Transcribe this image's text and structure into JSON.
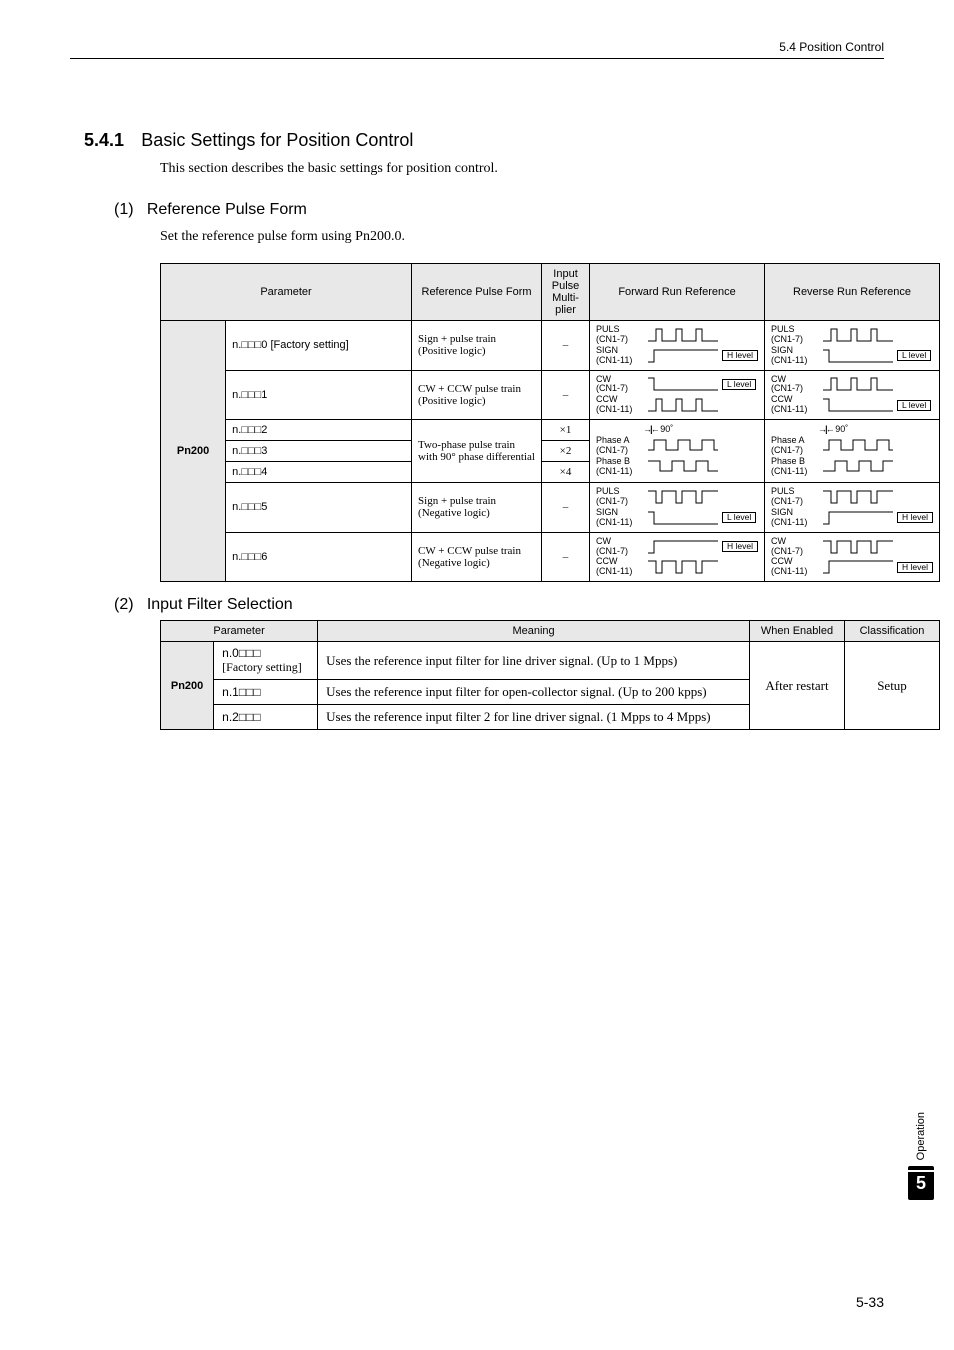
{
  "header": {
    "chapter_ref": "5.4  Position Control"
  },
  "section": {
    "number": "5.4.1",
    "title": "Basic Settings for Position Control",
    "desc": "This section describes the basic settings for position control."
  },
  "sub1": {
    "num": "(1)",
    "title": "Reference Pulse Form",
    "desc": "Set the reference pulse form using Pn200.0."
  },
  "table1": {
    "headers": {
      "param": "Parameter",
      "form": "Reference Pulse Form",
      "mult": "Input Pulse Multi-plier",
      "fwd": "Forward Run Reference",
      "rev": "Reverse Run Reference"
    },
    "pn": "Pn200",
    "rows": [
      {
        "val": "n.□□□0 [Factory setting]",
        "form": "Sign + pulse train (Positive logic)",
        "mult": "–",
        "fwd_sigs": [
          {
            "label": "PULS",
            "sub": "(CN1-7)",
            "wave": "pos-pulse",
            "boxed": ""
          },
          {
            "label": "SIGN",
            "sub": "(CN1-11)",
            "wave": "high",
            "boxed": "H level"
          }
        ],
        "rev_sigs": [
          {
            "label": "PULS",
            "sub": "(CN1-7)",
            "wave": "pos-pulse",
            "boxed": ""
          },
          {
            "label": "SIGN",
            "sub": "(CN1-11)",
            "wave": "low",
            "boxed": "L level"
          }
        ]
      },
      {
        "val": "n.□□□1",
        "form": "CW + CCW pulse train (Positive logic)",
        "mult": "–",
        "fwd_sigs": [
          {
            "label": "CW",
            "sub": "(CN1-7)",
            "wave": "low",
            "boxed": "L level"
          },
          {
            "label": "CCW",
            "sub": "(CN1-11)",
            "wave": "pos-pulse",
            "boxed": ""
          }
        ],
        "rev_sigs": [
          {
            "label": "CW",
            "sub": "(CN1-7)",
            "wave": "pos-pulse",
            "boxed": ""
          },
          {
            "label": "CCW",
            "sub": "(CN1-11)",
            "wave": "low",
            "boxed": "L level"
          }
        ]
      },
      {
        "val": "n.□□□2",
        "form_shared": "Two-phase pulse train with 90° phase differential",
        "mult": "×1",
        "phase_fwd": {
          "deg": "90˚",
          "arrows": "→||←",
          "a": "Phase A",
          "ac": "(CN1-7)",
          "b": "Phase B",
          "bc": "(CN1-11)",
          "type": "fwd"
        },
        "phase_rev": {
          "deg": "90˚",
          "arrows": "→||←",
          "a": "Phase A",
          "ac": "(CN1-7)",
          "b": "Phase B",
          "bc": "(CN1-11)",
          "type": "rev"
        }
      },
      {
        "val": "n.□□□3",
        "mult": "×2"
      },
      {
        "val": "n.□□□4",
        "mult": "×4"
      },
      {
        "val": "n.□□□5",
        "form": "Sign + pulse train (Negative logic)",
        "mult": "–",
        "fwd_sigs": [
          {
            "label": "PULS",
            "sub": "(CN1-7)",
            "wave": "neg-pulse",
            "boxed": ""
          },
          {
            "label": "SIGN",
            "sub": "(CN1-11)",
            "wave": "low",
            "boxed": "L level"
          }
        ],
        "rev_sigs": [
          {
            "label": "PULS",
            "sub": "(CN1-7)",
            "wave": "neg-pulse",
            "boxed": ""
          },
          {
            "label": "SIGN",
            "sub": "(CN1-11)",
            "wave": "high",
            "boxed": "H level"
          }
        ]
      },
      {
        "val": "n.□□□6",
        "form": "CW + CCW pulse train (Negative logic)",
        "mult": "–",
        "fwd_sigs": [
          {
            "label": "CW",
            "sub": "(CN1-7)",
            "wave": "high",
            "boxed": "H level"
          },
          {
            "label": "CCW",
            "sub": "(CN1-11)",
            "wave": "neg-pulse",
            "boxed": ""
          }
        ],
        "rev_sigs": [
          {
            "label": "CW",
            "sub": "(CN1-7)",
            "wave": "neg-pulse",
            "boxed": ""
          },
          {
            "label": "CCW",
            "sub": "(CN1-11)",
            "wave": "high",
            "boxed": "H level"
          }
        ]
      }
    ]
  },
  "sub2": {
    "num": "(2)",
    "title": "Input Filter Selection"
  },
  "table2": {
    "headers": {
      "param": "Parameter",
      "meaning": "Meaning",
      "when": "When Enabled",
      "class": "Classification"
    },
    "pn": "Pn200",
    "rows": [
      {
        "val": "n.0□□□",
        "sub": "[Factory setting]",
        "meaning": "Uses the reference input filter for line driver signal. (Up to 1 Mpps)"
      },
      {
        "val": "n.1□□□",
        "meaning": "Uses the reference input filter for open-collector signal. (Up to 200 kpps)"
      },
      {
        "val": "n.2□□□",
        "meaning": "Uses the reference input filter 2 for line driver signal. (1 Mpps to 4 Mpps)"
      }
    ],
    "when": "After restart",
    "class": "Setup"
  },
  "side": {
    "operation": "Operation",
    "chapter": "5"
  },
  "page": "5-33"
}
